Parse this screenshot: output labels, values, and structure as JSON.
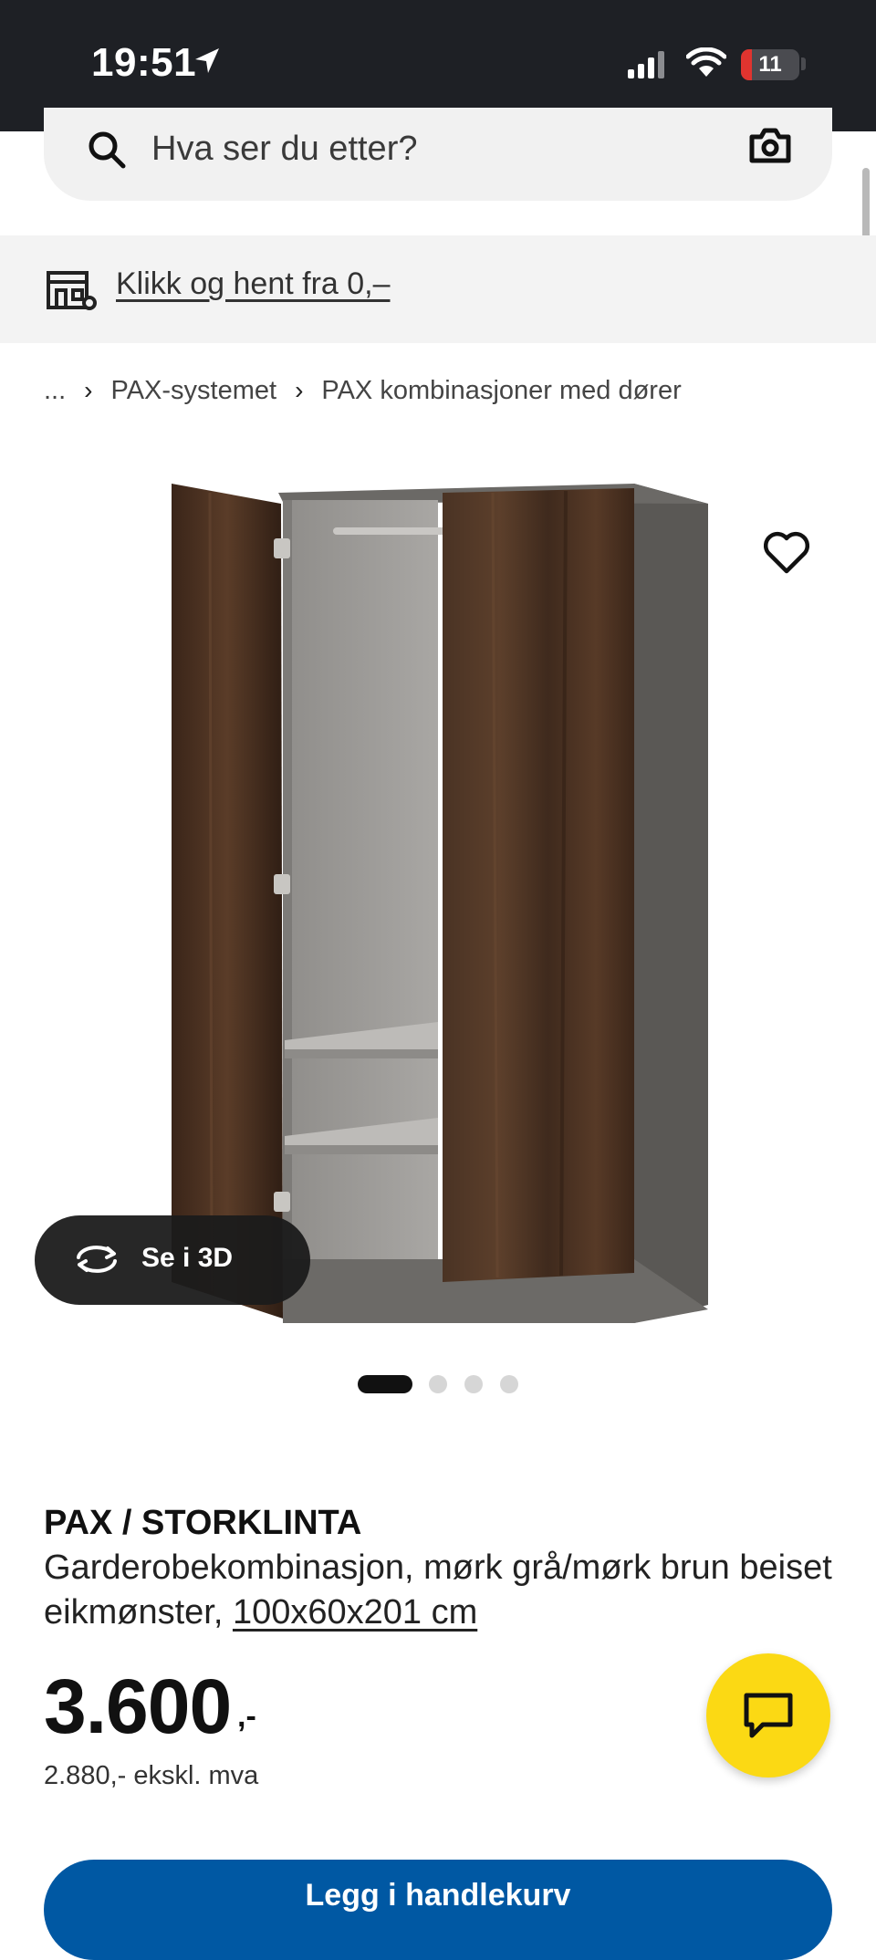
{
  "status_bar": {
    "time": "19:51",
    "battery_level": "11"
  },
  "search": {
    "placeholder": "Hva ser du etter?"
  },
  "banner": {
    "link_text": "Klikk og hent fra 0,–"
  },
  "breadcrumb": {
    "ellipsis": "...",
    "items": [
      "PAX-systemet",
      "PAX kombinasjoner med dører"
    ]
  },
  "gallery": {
    "view_3d_label": "Se i 3D",
    "page_count": 4,
    "active_page": 1
  },
  "product": {
    "name": "PAX / STORKLINTA",
    "description": "Garderobekombinasjon, mørk grå/mørk brun beiset eikmønster,",
    "size": "100x60x201 cm",
    "price": "3.600",
    "price_suffix": ",-",
    "price_ex_vat": "2.880,- ekskl. mva"
  },
  "actions": {
    "buy_label": "Legg i handlekurv"
  },
  "colors": {
    "accent_yellow": "#fbd914",
    "buy_blue": "#0058a3",
    "status_bar": "#1e2025",
    "battery_low": "#e0342f"
  }
}
